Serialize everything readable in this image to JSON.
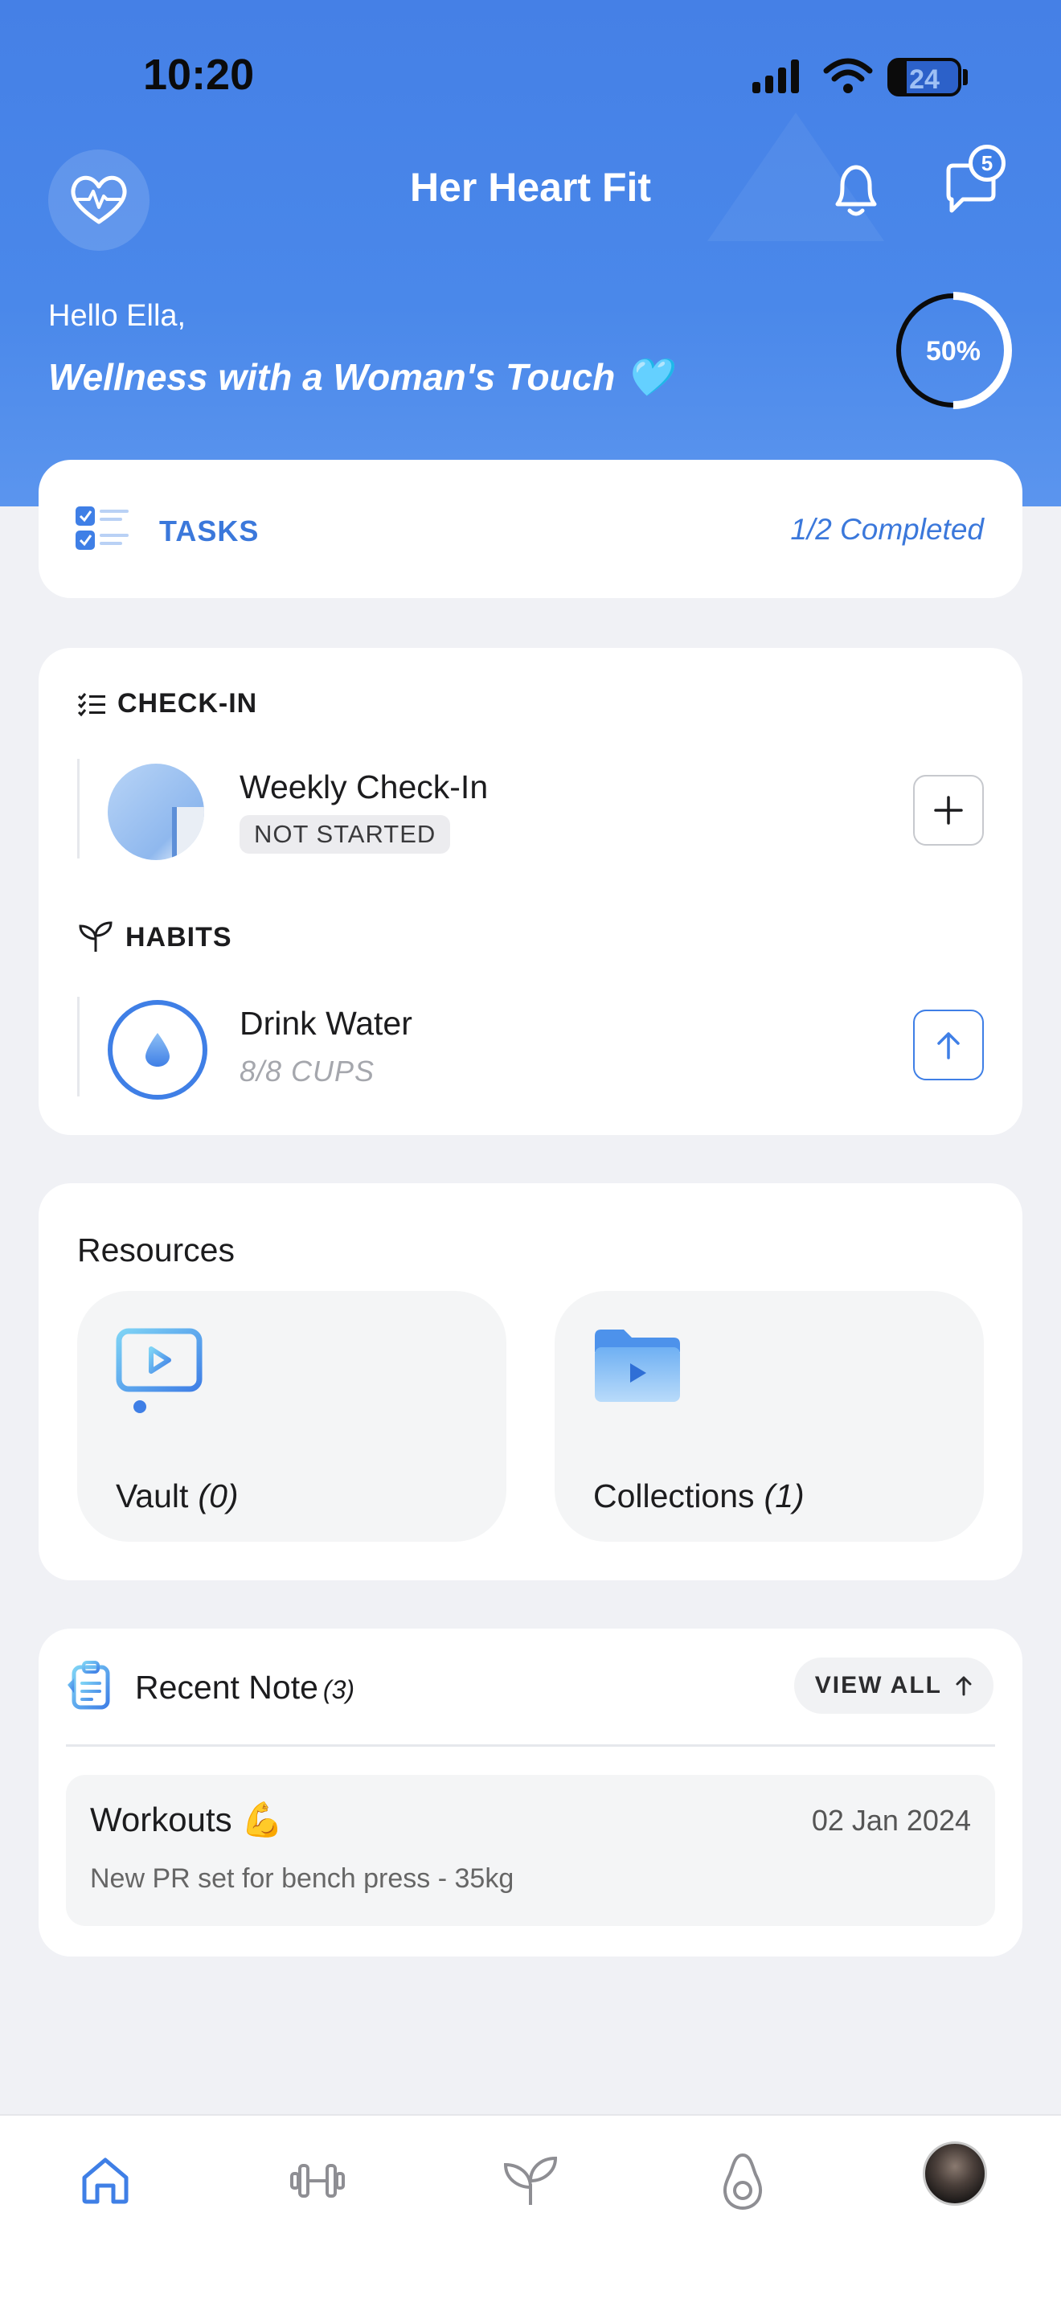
{
  "status_bar": {
    "time": "10:20",
    "battery": "24"
  },
  "header": {
    "title": "Her Heart Fit",
    "chat_badge": "5",
    "greeting": "Hello Ella,",
    "tagline": "Wellness with a Woman's Touch 🩵",
    "progress_label": "50%",
    "progress_value": 0.5
  },
  "tasks": {
    "label": "TASKS",
    "status": "1/2 Completed"
  },
  "checkin": {
    "section_label": "CHECK-IN",
    "item_title": "Weekly Check-In",
    "item_status": "NOT STARTED"
  },
  "habits": {
    "section_label": "HABITS",
    "item_title": "Drink Water",
    "item_progress": "8/8 CUPS"
  },
  "resources": {
    "title": "Resources",
    "tiles": [
      {
        "label": "Vault",
        "count": "(0)",
        "icon": "video-library-icon"
      },
      {
        "label": "Collections",
        "count": "(1)",
        "icon": "video-folder-icon"
      }
    ]
  },
  "notes": {
    "title": "Recent Note",
    "count": "(3)",
    "view_all": "VIEW ALL",
    "items": [
      {
        "title": "Workouts 💪",
        "date": "02 Jan 2024",
        "body": "New PR set for bench press - 35kg"
      }
    ]
  },
  "tabbar": {
    "items": [
      {
        "icon": "home-icon",
        "active": true
      },
      {
        "icon": "dumbbell-icon",
        "active": false
      },
      {
        "icon": "leaf-icon",
        "active": false
      },
      {
        "icon": "avocado-icon",
        "active": false
      },
      {
        "icon": "profile-avatar",
        "active": false
      }
    ]
  },
  "colors": {
    "accent": "#3f7fe6",
    "hero": "#4580e6",
    "background": "#f0f1f5"
  }
}
